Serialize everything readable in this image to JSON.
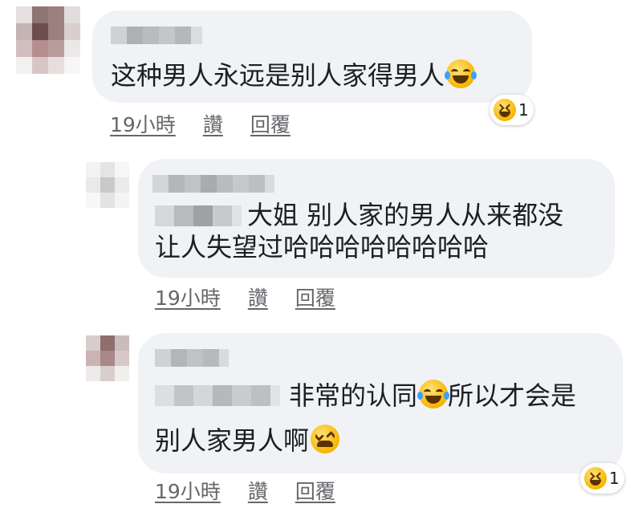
{
  "comments": [
    {
      "text_lines": [
        "这种男人永远是别人家得男人"
      ],
      "emoji": "laughing-tears-emoji",
      "time": "19小時",
      "like_label": "讚",
      "reply_label": "回覆",
      "reaction": {
        "icon": "grinning-squint-emoji",
        "count": "1"
      }
    },
    {
      "text_lines": [
        "大姐 别人家的男人从来都没",
        "让人失望过哈哈哈哈哈哈哈哈"
      ],
      "time": "19小時",
      "like_label": "讚",
      "reply_label": "回覆"
    },
    {
      "text_lines": [
        "非常的认同",
        "所以才会是",
        "别人家男人啊"
      ],
      "emoji_inline": "laughing-tears-emoji",
      "emoji_end": "tired-face-emoji",
      "time": "19小時",
      "like_label": "讚",
      "reply_label": "回覆",
      "reaction": {
        "icon": "grinning-squint-emoji",
        "count": "1"
      }
    }
  ],
  "colors": {
    "bubble": "#f0f2f5",
    "meta_text": "#65676b",
    "text": "#1c1e21"
  }
}
